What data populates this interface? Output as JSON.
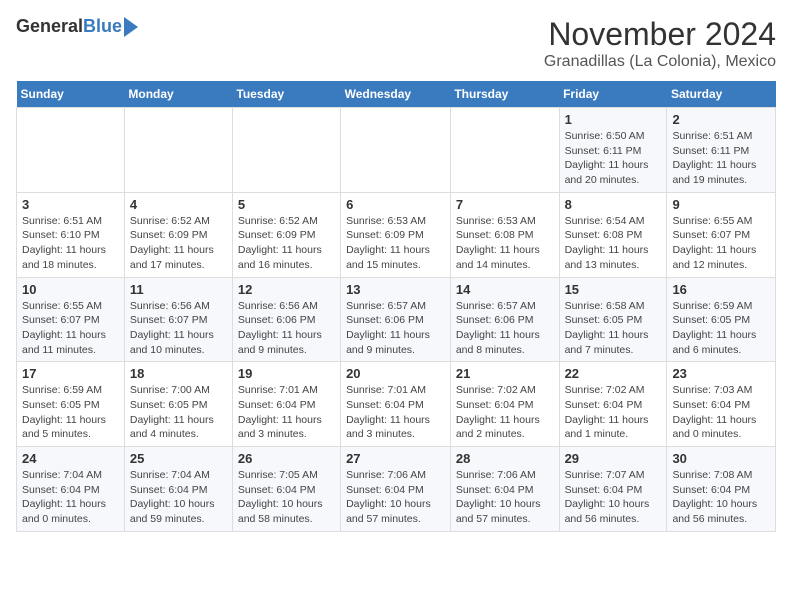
{
  "header": {
    "logo_general": "General",
    "logo_blue": "Blue",
    "month": "November 2024",
    "location": "Granadillas (La Colonia), Mexico"
  },
  "weekdays": [
    "Sunday",
    "Monday",
    "Tuesday",
    "Wednesday",
    "Thursday",
    "Friday",
    "Saturday"
  ],
  "weeks": [
    [
      {
        "day": "",
        "info": ""
      },
      {
        "day": "",
        "info": ""
      },
      {
        "day": "",
        "info": ""
      },
      {
        "day": "",
        "info": ""
      },
      {
        "day": "",
        "info": ""
      },
      {
        "day": "1",
        "info": "Sunrise: 6:50 AM\nSunset: 6:11 PM\nDaylight: 11 hours\nand 20 minutes."
      },
      {
        "day": "2",
        "info": "Sunrise: 6:51 AM\nSunset: 6:11 PM\nDaylight: 11 hours\nand 19 minutes."
      }
    ],
    [
      {
        "day": "3",
        "info": "Sunrise: 6:51 AM\nSunset: 6:10 PM\nDaylight: 11 hours\nand 18 minutes."
      },
      {
        "day": "4",
        "info": "Sunrise: 6:52 AM\nSunset: 6:09 PM\nDaylight: 11 hours\nand 17 minutes."
      },
      {
        "day": "5",
        "info": "Sunrise: 6:52 AM\nSunset: 6:09 PM\nDaylight: 11 hours\nand 16 minutes."
      },
      {
        "day": "6",
        "info": "Sunrise: 6:53 AM\nSunset: 6:09 PM\nDaylight: 11 hours\nand 15 minutes."
      },
      {
        "day": "7",
        "info": "Sunrise: 6:53 AM\nSunset: 6:08 PM\nDaylight: 11 hours\nand 14 minutes."
      },
      {
        "day": "8",
        "info": "Sunrise: 6:54 AM\nSunset: 6:08 PM\nDaylight: 11 hours\nand 13 minutes."
      },
      {
        "day": "9",
        "info": "Sunrise: 6:55 AM\nSunset: 6:07 PM\nDaylight: 11 hours\nand 12 minutes."
      }
    ],
    [
      {
        "day": "10",
        "info": "Sunrise: 6:55 AM\nSunset: 6:07 PM\nDaylight: 11 hours\nand 11 minutes."
      },
      {
        "day": "11",
        "info": "Sunrise: 6:56 AM\nSunset: 6:07 PM\nDaylight: 11 hours\nand 10 minutes."
      },
      {
        "day": "12",
        "info": "Sunrise: 6:56 AM\nSunset: 6:06 PM\nDaylight: 11 hours\nand 9 minutes."
      },
      {
        "day": "13",
        "info": "Sunrise: 6:57 AM\nSunset: 6:06 PM\nDaylight: 11 hours\nand 9 minutes."
      },
      {
        "day": "14",
        "info": "Sunrise: 6:57 AM\nSunset: 6:06 PM\nDaylight: 11 hours\nand 8 minutes."
      },
      {
        "day": "15",
        "info": "Sunrise: 6:58 AM\nSunset: 6:05 PM\nDaylight: 11 hours\nand 7 minutes."
      },
      {
        "day": "16",
        "info": "Sunrise: 6:59 AM\nSunset: 6:05 PM\nDaylight: 11 hours\nand 6 minutes."
      }
    ],
    [
      {
        "day": "17",
        "info": "Sunrise: 6:59 AM\nSunset: 6:05 PM\nDaylight: 11 hours\nand 5 minutes."
      },
      {
        "day": "18",
        "info": "Sunrise: 7:00 AM\nSunset: 6:05 PM\nDaylight: 11 hours\nand 4 minutes."
      },
      {
        "day": "19",
        "info": "Sunrise: 7:01 AM\nSunset: 6:04 PM\nDaylight: 11 hours\nand 3 minutes."
      },
      {
        "day": "20",
        "info": "Sunrise: 7:01 AM\nSunset: 6:04 PM\nDaylight: 11 hours\nand 3 minutes."
      },
      {
        "day": "21",
        "info": "Sunrise: 7:02 AM\nSunset: 6:04 PM\nDaylight: 11 hours\nand 2 minutes."
      },
      {
        "day": "22",
        "info": "Sunrise: 7:02 AM\nSunset: 6:04 PM\nDaylight: 11 hours\nand 1 minute."
      },
      {
        "day": "23",
        "info": "Sunrise: 7:03 AM\nSunset: 6:04 PM\nDaylight: 11 hours\nand 0 minutes."
      }
    ],
    [
      {
        "day": "24",
        "info": "Sunrise: 7:04 AM\nSunset: 6:04 PM\nDaylight: 11 hours\nand 0 minutes."
      },
      {
        "day": "25",
        "info": "Sunrise: 7:04 AM\nSunset: 6:04 PM\nDaylight: 10 hours\nand 59 minutes."
      },
      {
        "day": "26",
        "info": "Sunrise: 7:05 AM\nSunset: 6:04 PM\nDaylight: 10 hours\nand 58 minutes."
      },
      {
        "day": "27",
        "info": "Sunrise: 7:06 AM\nSunset: 6:04 PM\nDaylight: 10 hours\nand 57 minutes."
      },
      {
        "day": "28",
        "info": "Sunrise: 7:06 AM\nSunset: 6:04 PM\nDaylight: 10 hours\nand 57 minutes."
      },
      {
        "day": "29",
        "info": "Sunrise: 7:07 AM\nSunset: 6:04 PM\nDaylight: 10 hours\nand 56 minutes."
      },
      {
        "day": "30",
        "info": "Sunrise: 7:08 AM\nSunset: 6:04 PM\nDaylight: 10 hours\nand 56 minutes."
      }
    ]
  ]
}
